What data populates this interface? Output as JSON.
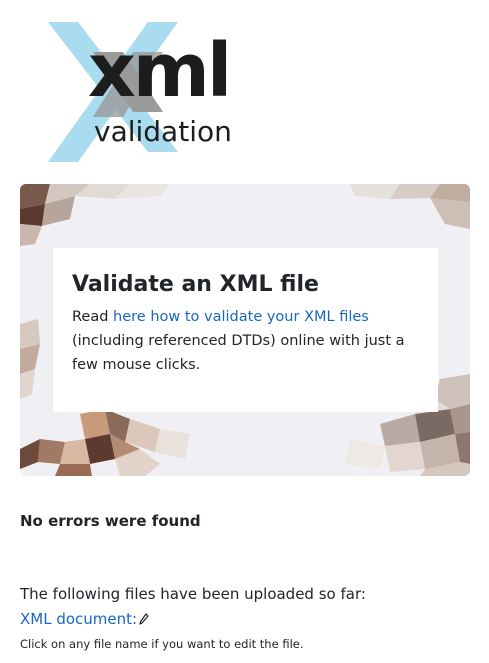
{
  "logo": {
    "main_text": "xml",
    "sub_text": "validation",
    "icon": "xml-validation-logo"
  },
  "hero": {
    "title": "Validate an XML file",
    "text_before": "Read ",
    "link_text": "here how to validate your XML files",
    "text_after": " (including referenced DTDs) online with just a few mouse clicks."
  },
  "status": {
    "message": "No errors were found"
  },
  "files": {
    "intro": "The following files have been uploaded so far:",
    "items": [
      {
        "label": "XML document:",
        "icon": "pencil-edit-icon"
      }
    ],
    "hint": "Click on any file name if you want to edit the file."
  },
  "colors": {
    "link": "#1a66c4",
    "text": "#212529",
    "logo_x_light": "#a9dcef",
    "logo_x_dark": "#9a9a9a"
  }
}
